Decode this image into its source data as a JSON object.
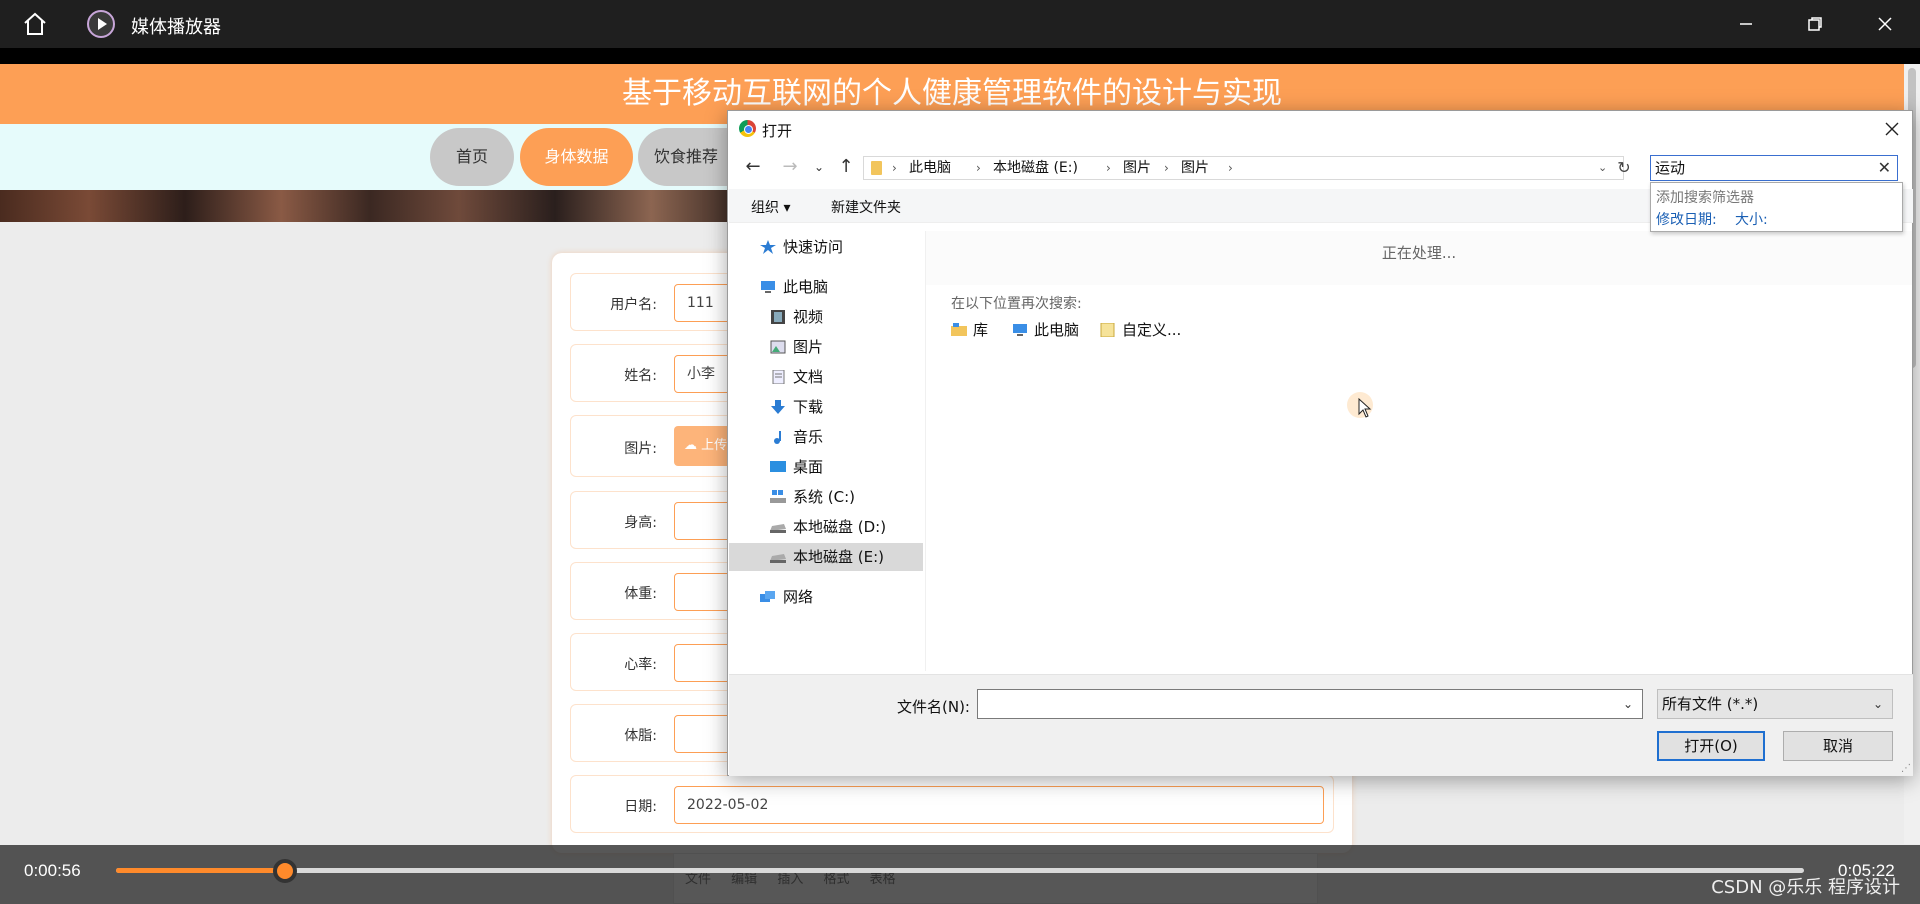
{
  "player": {
    "title": "媒体播放器",
    "current_time": "0:00:56",
    "total_time": "0:05:22",
    "progress": 0.1,
    "watermark": "CSDN @乐乐 程序设计",
    "accent": "#ff8a2b"
  },
  "web": {
    "header_title": "基于移动互联网的个人健康管理软件的设计与实现",
    "nav": [
      "首页",
      "身体数据",
      "饮食推荐"
    ],
    "form": {
      "username_label": "用户名:",
      "username_value": "111",
      "name_label": "姓名:",
      "name_value": "小李",
      "image_label": "图片:",
      "upload_label": "上传",
      "height_label": "身高:",
      "weight_label": "体重:",
      "heartrate_label": "心率:",
      "bodyfat_label": "体脂:",
      "date_label": "日期:",
      "date_value": "2022-05-02"
    },
    "editor_menu": [
      "文件",
      "编辑",
      "插入",
      "格式",
      "表格"
    ],
    "brand_color": "#fd9f55"
  },
  "dialog": {
    "title": "打开",
    "breadcrumb": [
      "此电脑",
      "本地磁盘 (E:)",
      "图片",
      "图片"
    ],
    "search_value": "运动",
    "search_hint": "添加搜索筛选器",
    "search_filter_date": "修改日期:",
    "search_filter_size": "大小:",
    "toolbar": {
      "organize": "组织 ▾",
      "new_folder": "新建文件夹"
    },
    "nav_items": [
      {
        "label": "快速访问",
        "icon": "star-icon"
      },
      {
        "label": "此电脑",
        "icon": "computer-icon"
      },
      {
        "label": "视频",
        "icon": "video-icon"
      },
      {
        "label": "图片",
        "icon": "pictures-icon"
      },
      {
        "label": "文档",
        "icon": "document-icon"
      },
      {
        "label": "下载",
        "icon": "download-icon"
      },
      {
        "label": "音乐",
        "icon": "music-icon"
      },
      {
        "label": "桌面",
        "icon": "desktop-icon"
      },
      {
        "label": "系统 (C:)",
        "icon": "system-drive-icon"
      },
      {
        "label": "本地磁盘 (D:)",
        "icon": "drive-icon"
      },
      {
        "label": "本地磁盘 (E:)",
        "icon": "drive-icon"
      },
      {
        "label": "网络",
        "icon": "network-icon"
      }
    ],
    "processing_text": "正在处理...",
    "search_again_text": "在以下位置再次搜索:",
    "search_locations": [
      "库",
      "此电脑",
      "自定义..."
    ],
    "filename_label": "文件名(N):",
    "filename_value": "",
    "filetype_value": "所有文件 (*.*)",
    "open_button": "打开(O)",
    "cancel_button": "取消"
  }
}
